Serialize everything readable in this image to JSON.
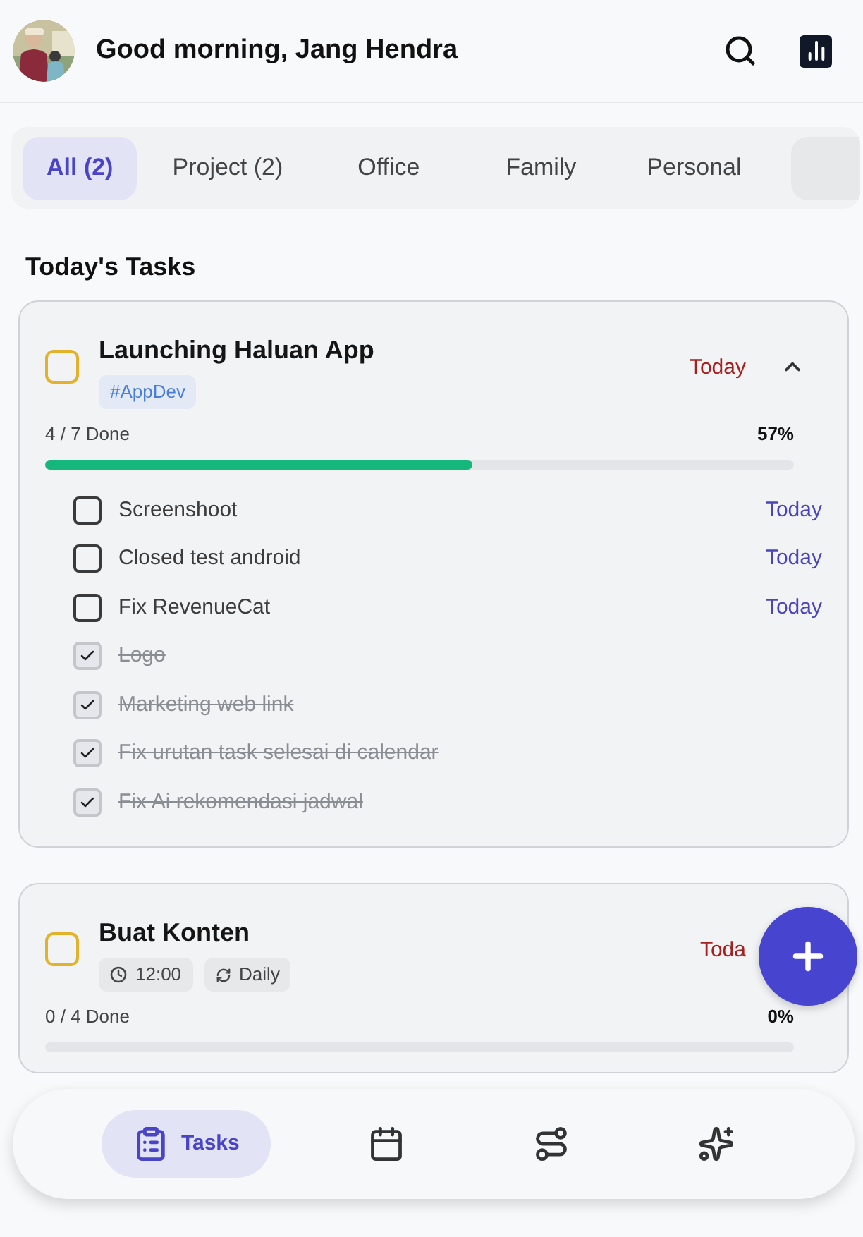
{
  "header": {
    "greeting": "Good morning, Jang Hendra"
  },
  "tabs": [
    {
      "label": "All (2)",
      "selected": true
    },
    {
      "label": "Project (2)",
      "selected": false
    },
    {
      "label": "Office",
      "selected": false
    },
    {
      "label": "Family",
      "selected": false
    },
    {
      "label": "Personal",
      "selected": false
    }
  ],
  "section_title": "Today's Tasks",
  "tasks": [
    {
      "title": "Launching Haluan App",
      "checked": false,
      "expanded": true,
      "due": "Today",
      "tags": [
        {
          "kind": "hashtag",
          "label": "#AppDev"
        }
      ],
      "progress_text": "4 / 7 Done",
      "percent": "57%",
      "level": 0.57,
      "subtasks": [
        {
          "title": "Screenshoot",
          "checked": false,
          "due": "Today"
        },
        {
          "title": "Closed test android",
          "checked": false,
          "due": "Today"
        },
        {
          "title": "Fix RevenueCat",
          "checked": false,
          "due": "Today"
        },
        {
          "title": "Logo",
          "checked": true
        },
        {
          "title": "Marketing web link",
          "checked": true
        },
        {
          "title": "Fix urutan task selesai di calendar",
          "checked": true
        },
        {
          "title": "Fix Ai rekomendasi jadwal",
          "checked": true
        }
      ]
    },
    {
      "title": "Buat Konten",
      "checked": false,
      "due": "Toda",
      "tags": [
        {
          "kind": "time",
          "label": "12:00"
        },
        {
          "kind": "repeat",
          "label": "Daily"
        }
      ],
      "progress_text": "0 / 4 Done",
      "percent": "0%",
      "level": 0
    }
  ],
  "nav": [
    {
      "kind": "tasks",
      "label": "Tasks",
      "selected": true
    },
    {
      "kind": "calendar",
      "selected": false
    },
    {
      "kind": "route",
      "selected": false
    },
    {
      "kind": "sparkles",
      "selected": false
    }
  ]
}
